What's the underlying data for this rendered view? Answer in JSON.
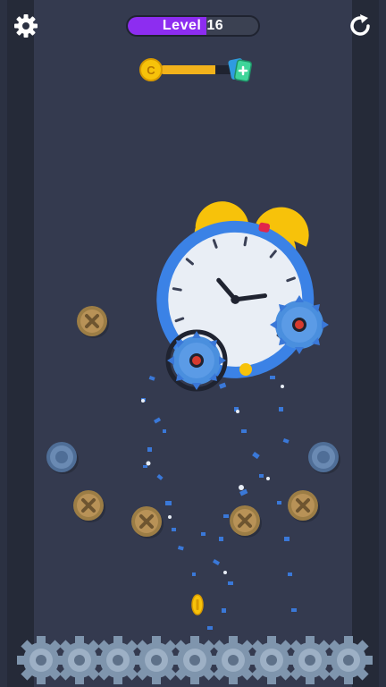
{
  "hud": {
    "level_label": "Level",
    "level_number": "16",
    "level_color": "#8d2df0",
    "coin_symbol": "C"
  },
  "progress": {
    "fraction": 0.75,
    "fill_color": "#f2b21b"
  },
  "icons": {
    "settings": "gear-icon",
    "restart": "restart-icon",
    "coin": "coin-icon",
    "reward": "card-plus-icon"
  },
  "colors": {
    "background": "#343a4f",
    "clock_body": "#3b82e6",
    "clock_bell": "#f7c20a",
    "screw_gold": "#9c7d45",
    "screw_blue": "#4f6e97",
    "saw_blade": "#4a8fde",
    "gear": "#7f95ad"
  },
  "screws": [
    {
      "kind": "gold"
    },
    {
      "kind": "blue"
    },
    {
      "kind": "gold"
    },
    {
      "kind": "gold"
    },
    {
      "kind": "gold"
    },
    {
      "kind": "gold"
    },
    {
      "kind": "blue"
    },
    {
      "kind": "gold"
    }
  ],
  "saws": [
    {
      "label": "saw-left"
    },
    {
      "label": "saw-right"
    }
  ],
  "gears_count": 9
}
